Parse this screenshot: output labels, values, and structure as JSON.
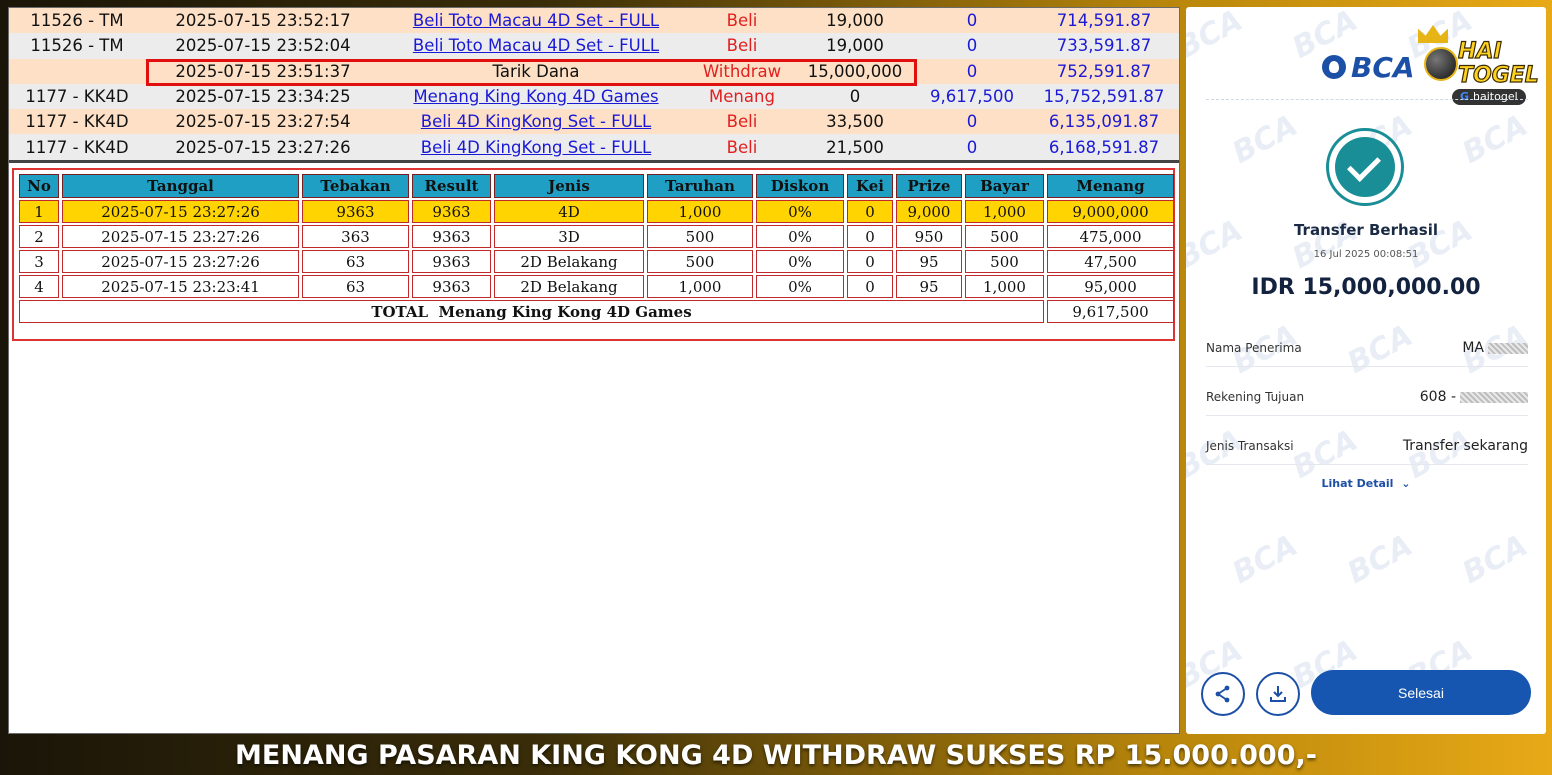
{
  "transactions": [
    {
      "id": "11526 - TM",
      "date": "2025-07-15 23:52:17",
      "desc": "Beli Toto Macau 4D Set - FULL",
      "type": "Beli",
      "debit": "19,000",
      "credit": "0",
      "balance": "714,591.87",
      "link": true,
      "shade": "peach"
    },
    {
      "id": "11526 - TM",
      "date": "2025-07-15 23:52:04",
      "desc": "Beli Toto Macau 4D Set - FULL",
      "type": "Beli",
      "debit": "19,000",
      "credit": "0",
      "balance": "733,591.87",
      "link": true,
      "shade": "grey"
    },
    {
      "id": "",
      "date": "2025-07-15 23:51:37",
      "desc": "Tarik Dana",
      "type": "Withdraw",
      "debit": "15,000,000",
      "credit": "0",
      "balance": "752,591.87",
      "link": false,
      "shade": "peach"
    },
    {
      "id": "1177 - KK4D",
      "date": "2025-07-15 23:34:25",
      "desc": "Menang King Kong 4D Games",
      "type": "Menang",
      "debit": "0",
      "credit": "9,617,500",
      "balance": "15,752,591.87",
      "link": true,
      "shade": "grey"
    },
    {
      "id": "1177 - KK4D",
      "date": "2025-07-15 23:27:54",
      "desc": "Beli 4D KingKong Set - FULL",
      "type": "Beli",
      "debit": "33,500",
      "credit": "0",
      "balance": "6,135,091.87",
      "link": true,
      "shade": "peach"
    },
    {
      "id": "1177 - KK4D",
      "date": "2025-07-15 23:27:26",
      "desc": "Beli 4D KingKong Set - FULL",
      "type": "Beli",
      "debit": "21,500",
      "credit": "0",
      "balance": "6,168,591.87",
      "link": true,
      "shade": "grey"
    }
  ],
  "win_table": {
    "headers": [
      "No",
      "Tanggal",
      "Tebakan",
      "Result",
      "Jenis",
      "Taruhan",
      "Diskon",
      "Kei",
      "Prize",
      "Bayar",
      "Menang"
    ],
    "rows": [
      [
        "1",
        "2025-07-15 23:27:26",
        "9363",
        "9363",
        "4D",
        "1,000",
        "0%",
        "0",
        "9,000",
        "1,000",
        "9,000,000"
      ],
      [
        "2",
        "2025-07-15 23:27:26",
        "363",
        "9363",
        "3D",
        "500",
        "0%",
        "0",
        "950",
        "500",
        "475,000"
      ],
      [
        "3",
        "2025-07-15 23:27:26",
        "63",
        "9363",
        "2D Belakang",
        "500",
        "0%",
        "0",
        "95",
        "500",
        "47,500"
      ],
      [
        "4",
        "2025-07-15 23:23:41",
        "63",
        "9363",
        "2D Belakang",
        "1,000",
        "0%",
        "0",
        "95",
        "1,000",
        "95,000"
      ]
    ],
    "total_label": "TOTAL  Menang King Kong 4D Games",
    "total_value": "9,617,500"
  },
  "receipt": {
    "bank_logo": "BCA",
    "watermark": "BCA",
    "brand_top": "HAI",
    "brand_bottom": "TOGEL",
    "brand_badge_g": "G",
    "brand_badge": "haitogel",
    "status": "Transfer Berhasil",
    "date": "16 Jul 2025 00:08:51",
    "amount": "IDR 15,000,000.00",
    "fields": [
      {
        "label": "Nama Penerima",
        "value": "MA"
      },
      {
        "label": "Rekening Tujuan",
        "value": "608 -"
      },
      {
        "label": "Jenis Transaksi",
        "value": "Transfer sekarang"
      }
    ],
    "detail_link": "Lihat Detail",
    "share_icon": "share-icon",
    "download_icon": "download-icon",
    "done_label": "Selesai"
  },
  "banner": {
    "text": "MENANG PASARAN KING KONG 4D WITHDRAW SUKSES RP 15.000.000,-"
  },
  "colors": {
    "link": "#1a1ad6",
    "type_red": "#e12020",
    "header_cyan": "#1f9fc4",
    "highlight_yellow": "#ffd400",
    "bca_blue": "#1c4fa6",
    "success_teal": "#1a8e96"
  }
}
